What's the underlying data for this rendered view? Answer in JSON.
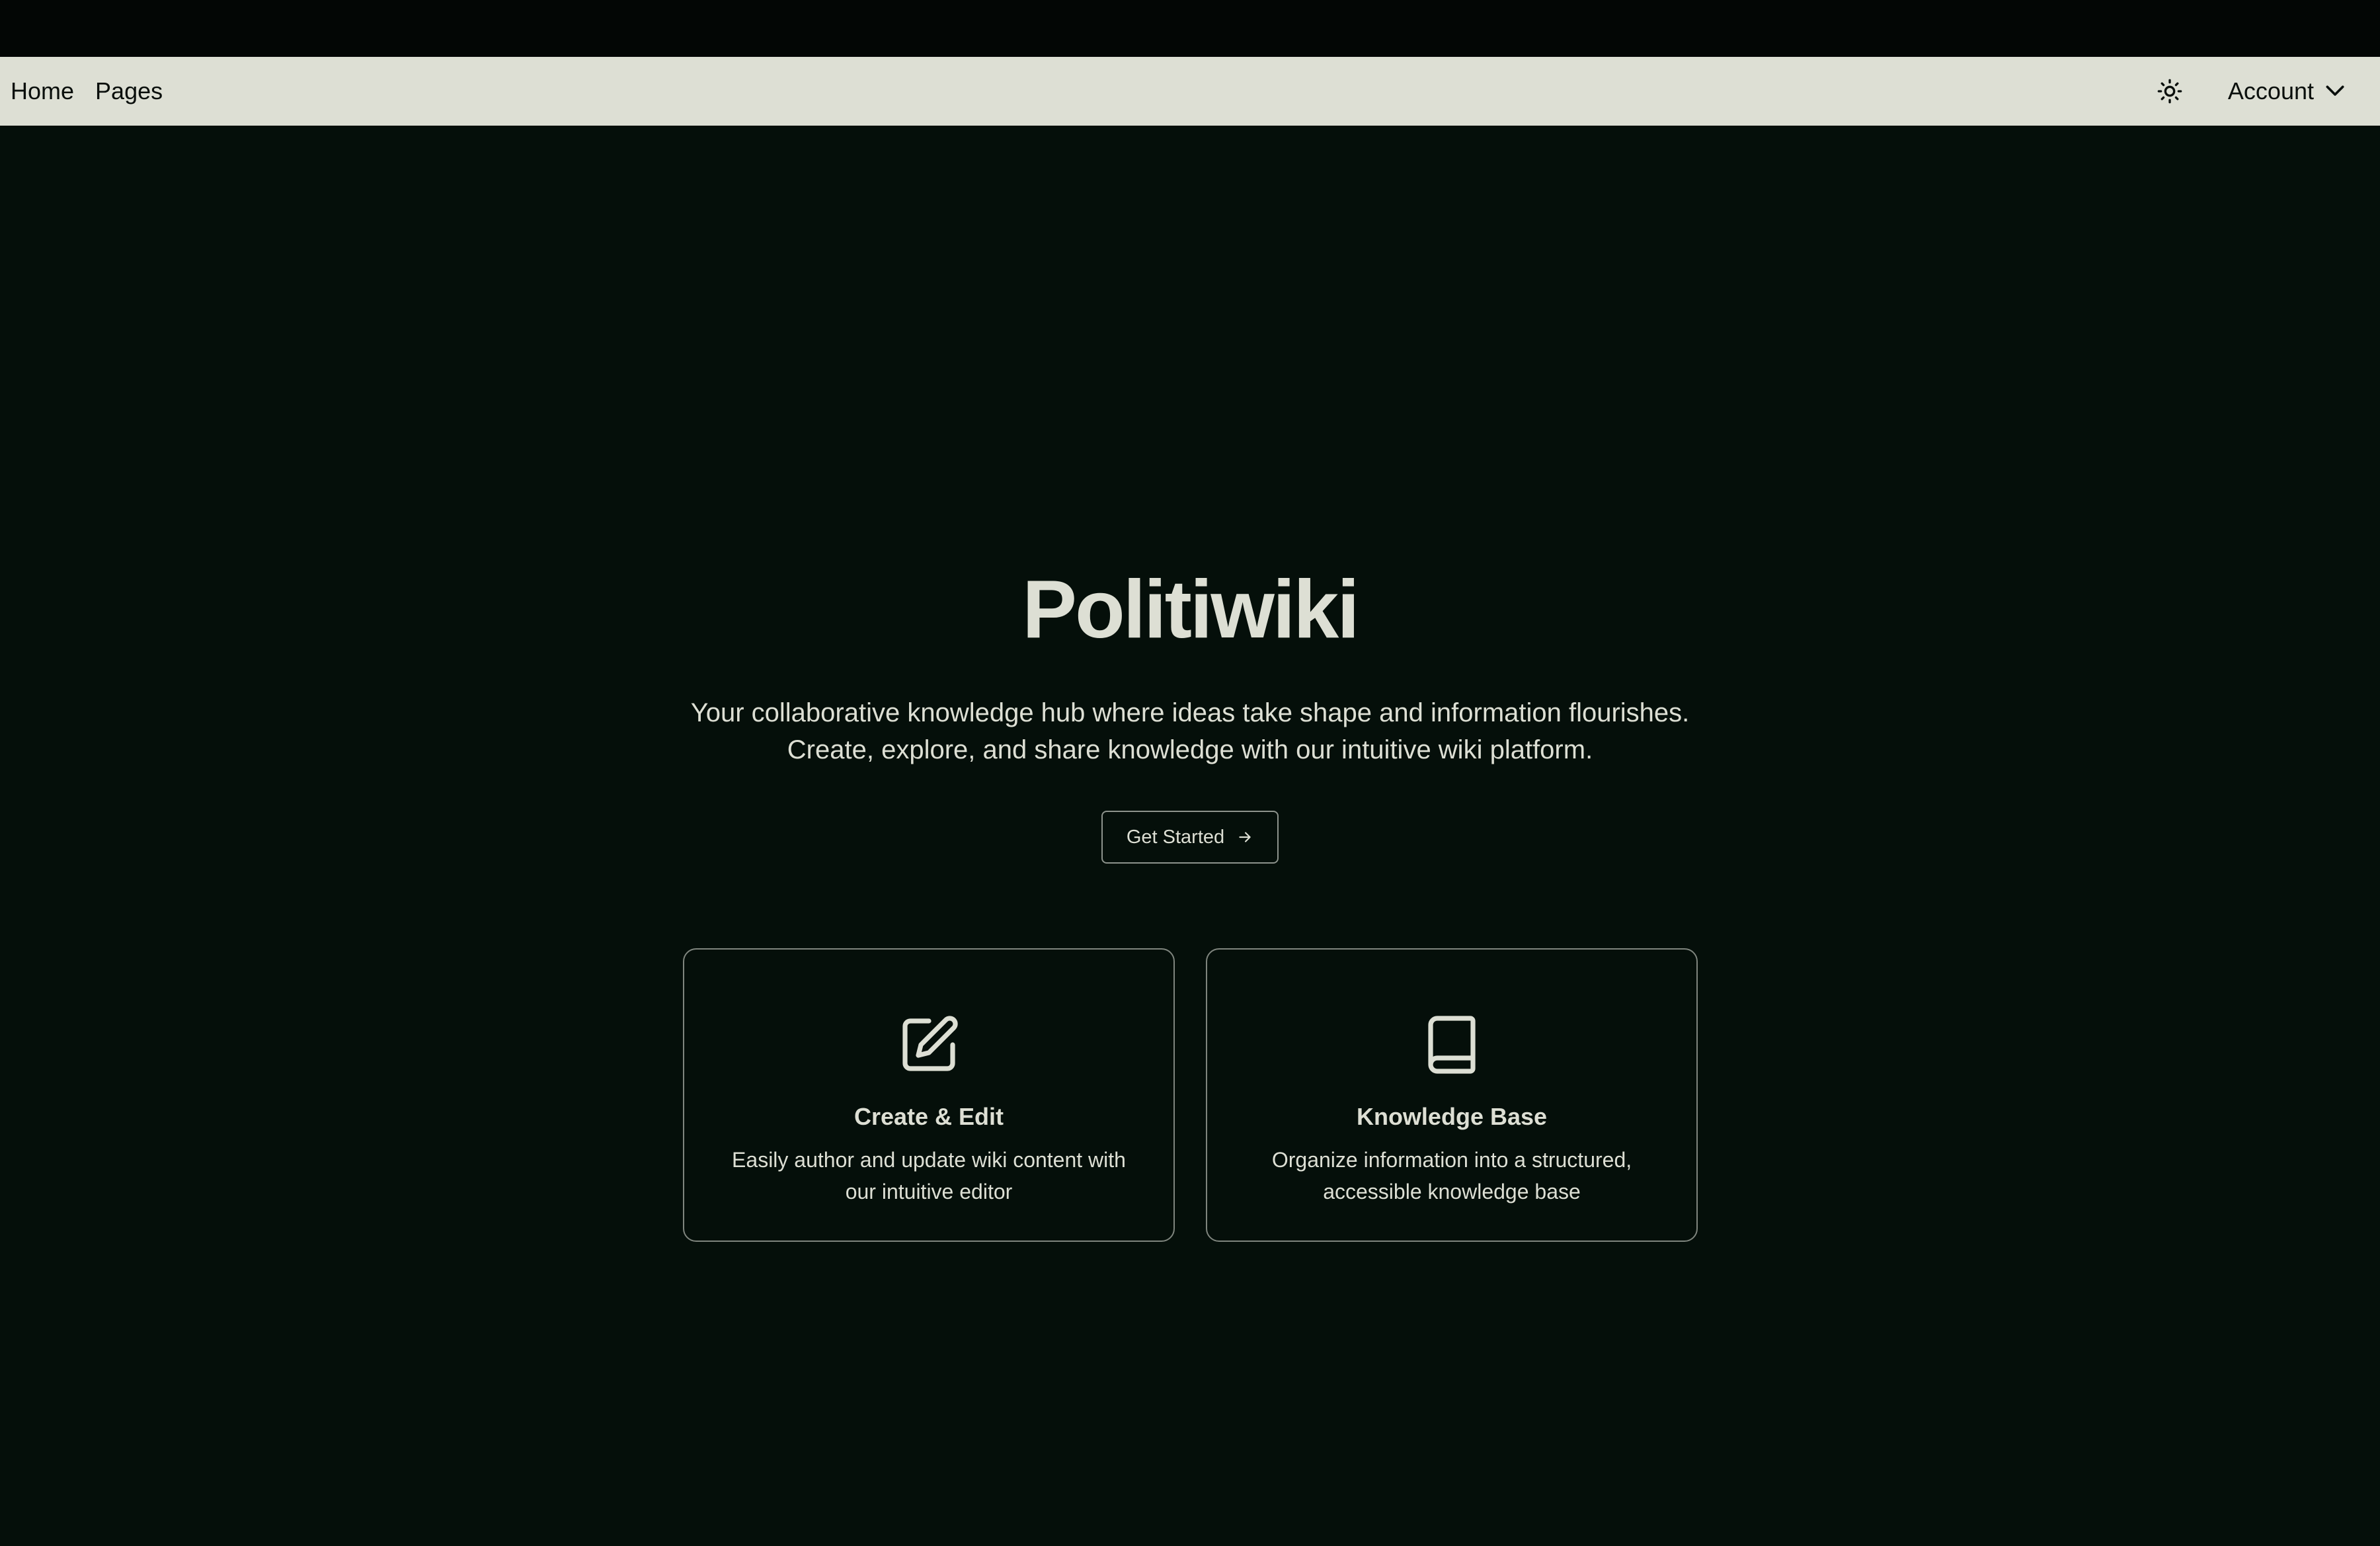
{
  "nav": {
    "links": [
      "Home",
      "Pages"
    ],
    "theme_toggle_icon": "sun-icon",
    "account_label": "Account",
    "account_icon": "chevron-down-icon"
  },
  "hero": {
    "title": "Politiwiki",
    "subtitle": "Your collaborative knowledge hub where ideas take shape and information flourishes. Create, explore, and share knowledge with our intuitive wiki platform.",
    "cta_label": "Get Started",
    "cta_icon": "arrow-right-icon"
  },
  "features": [
    {
      "icon": "edit-icon",
      "title": "Create & Edit",
      "description": "Easily author and update wiki content with our intuitive editor"
    },
    {
      "icon": "book-icon",
      "title": "Knowledge Base",
      "description": "Organize information into a structured, accessible knowledge base"
    }
  ],
  "colors": {
    "background": "#050f0a",
    "navbar": "#dddfd4",
    "text_light": "#dddfd4",
    "text_dark": "#0a0f0c",
    "border": "#7f857e"
  }
}
